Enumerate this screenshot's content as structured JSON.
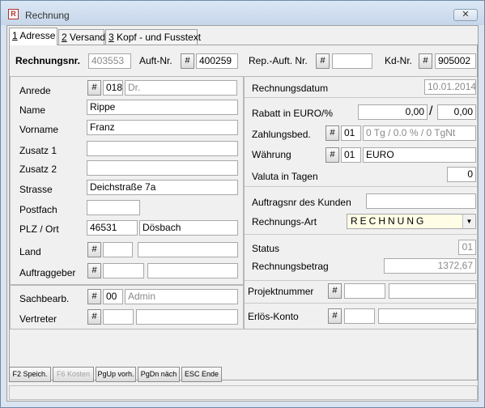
{
  "window": {
    "title": "Rechnung",
    "close_label": "✕",
    "app_icon": "invoice-app-icon"
  },
  "tabs": [
    {
      "key": "1",
      "rest": " Adresse"
    },
    {
      "key": "2",
      "rest": " Versand"
    },
    {
      "key": "3",
      "rest": " Kopf - und Fusstext"
    }
  ],
  "hash": "#",
  "header": {
    "rechnungsnr_label": "Rechnungsnr.",
    "rechnungsnr": "403553",
    "auftrnr_label": "Auft-Nr.",
    "auftrnr": "400259",
    "repauftnr_label": "Rep.-Auft. Nr.",
    "repauftnr": "",
    "kdnr_label": "Kd-Nr.",
    "kdnr": "905002"
  },
  "address": {
    "anrede_label": "Anrede",
    "anrede_code": "018",
    "anrede_text": "Dr.",
    "name_label": "Name",
    "name": "Rippe",
    "vorname_label": "Vorname",
    "vorname": "Franz",
    "zusatz1_label": "Zusatz 1",
    "zusatz1": "",
    "zusatz2_label": "Zusatz 2",
    "zusatz2": "",
    "strasse_label": "Strasse",
    "strasse": "Deichstraße 7a",
    "postfach_label": "Postfach",
    "postfach": "",
    "plz_label": "PLZ / Ort",
    "plz": "46531",
    "ort": "Dösbach",
    "land_label": "Land",
    "land_code": "",
    "land_text": "",
    "auftraggeber_label": "Auftraggeber",
    "auftraggeber_code": "",
    "auftraggeber_text": ""
  },
  "staff": {
    "sachbearb_label": "Sachbearb.",
    "sachbearb_code": "00",
    "sachbearb_text": "Admin",
    "vertreter_label": "Vertreter",
    "vertreter_code": "",
    "vertreter_text": ""
  },
  "invoice": {
    "datum_label": "Rechnungsdatum",
    "datum": "10.01.2014",
    "rabatt_label": "Rabatt in EURO/%",
    "rabatt_euro": "0,00",
    "rabatt_slash": "/",
    "rabatt_pct": "0,00",
    "zahlung_label": "Zahlungsbed.",
    "zahlung_code": "01",
    "zahlung_text": "0 Tg / 0.0 % / 0 TgNt",
    "waehrung_label": "Währung",
    "waehrung_code": "01",
    "waehrung_text": "EURO",
    "valuta_label": "Valuta in Tagen",
    "valuta": "0",
    "auftragsnr_label": "Auftragsnr des Kunden",
    "auftragsnr": "",
    "art_label": "Rechnungs-Art",
    "art": "RECHNUNG",
    "status_label": "Status",
    "status": "01",
    "betrag_label": "Rechnungsbetrag",
    "betrag": "1372,67",
    "projekt_label": "Projektnummer",
    "projekt_code": "",
    "projekt_text": "",
    "erloes_label": "Erlös-Konto",
    "erloes_code": "",
    "erloes_text": ""
  },
  "footer_buttons": [
    "F2 Speich.",
    "F6 Kosten",
    "PgUp vorh.",
    "PgDn näch",
    "ESC Ende"
  ]
}
